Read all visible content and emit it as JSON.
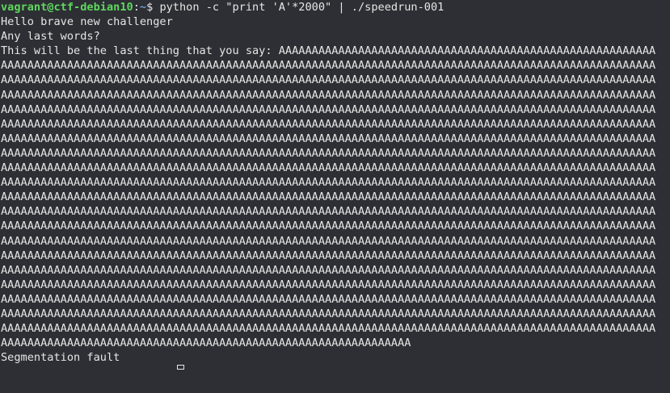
{
  "prompt": {
    "user_host": "vagrant@ctf-debian10",
    "separator": ":",
    "path": "~",
    "symbol": "$ ",
    "command": "python -c \"print 'A'*2000\" | ./speedrun-001"
  },
  "output": {
    "line1": "Hello brave new challenger",
    "line2": "Any last words?",
    "line3_prefix": "This will be the last thing that you say: ",
    "repeat_char": "A",
    "payload_length": 2000,
    "error": "Segmentation fault"
  }
}
